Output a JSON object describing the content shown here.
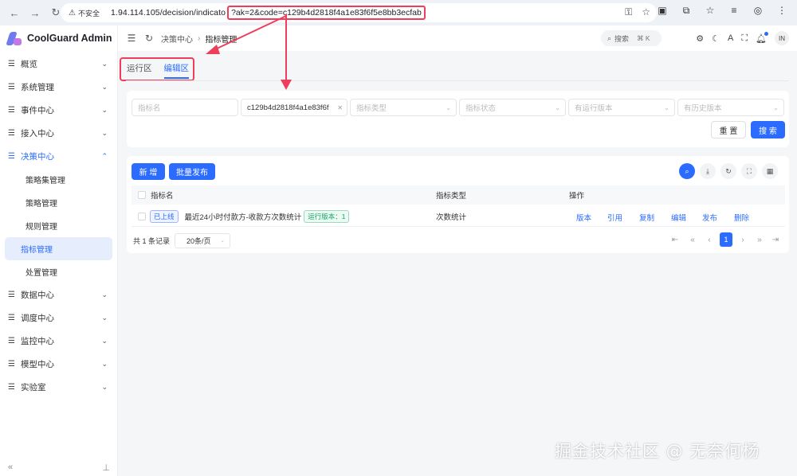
{
  "browser": {
    "insecure_label": "不安全",
    "url_host": "1.94.114.105/decision/indicato",
    "url_query": "?ak=2&code=c129b4d2818f4a1e83f6f5e8bb3ecfab"
  },
  "app": {
    "name": "CoolGuard Admin"
  },
  "sidebar": {
    "items": [
      {
        "label": "概览"
      },
      {
        "label": "系统管理"
      },
      {
        "label": "事件中心"
      },
      {
        "label": "接入中心"
      },
      {
        "label": "决策中心"
      },
      {
        "label": "数据中心"
      },
      {
        "label": "调度中心"
      },
      {
        "label": "监控中心"
      },
      {
        "label": "模型中心"
      },
      {
        "label": "实验室"
      }
    ],
    "sub_items": [
      {
        "label": "策略集管理"
      },
      {
        "label": "策略管理"
      },
      {
        "label": "规则管理"
      },
      {
        "label": "指标管理"
      },
      {
        "label": "处置管理"
      }
    ]
  },
  "header": {
    "breadcrumb": [
      "决策中心",
      "指标管理"
    ],
    "search_label": "搜索",
    "search_kbd": "⌘ K",
    "avatar": "IN"
  },
  "tabs": [
    {
      "label": "运行区"
    },
    {
      "label": "编辑区"
    }
  ],
  "filters": {
    "name_placeholder": "指标名",
    "code_value": "c129b4d2818f4a1e83f6f",
    "type_placeholder": "指标类型",
    "status_placeholder": "指标状态",
    "running_version_placeholder": "有运行版本",
    "history_version_placeholder": "有历史版本",
    "reset_label": "重 置",
    "search_label": "搜 索"
  },
  "table": {
    "add_label": "新 增",
    "batch_publish_label": "批量发布",
    "columns": [
      "指标名",
      "指标类型",
      "操作"
    ],
    "rows": [
      {
        "status": "已上线",
        "name": "最近24小时付款方-收款方次数统计",
        "version": "运行版本：1",
        "type": "次数统计",
        "actions": [
          "版本",
          "引用",
          "复制",
          "编辑",
          "发布",
          "删除"
        ]
      }
    ],
    "total": "共 1 条记录",
    "page_size": "20条/页",
    "current_page": "1"
  },
  "watermark": "掘金技术社区 @ 无奈何杨",
  "colors": {
    "primary": "#2b6cff",
    "highlight": "#ef3e5c"
  }
}
